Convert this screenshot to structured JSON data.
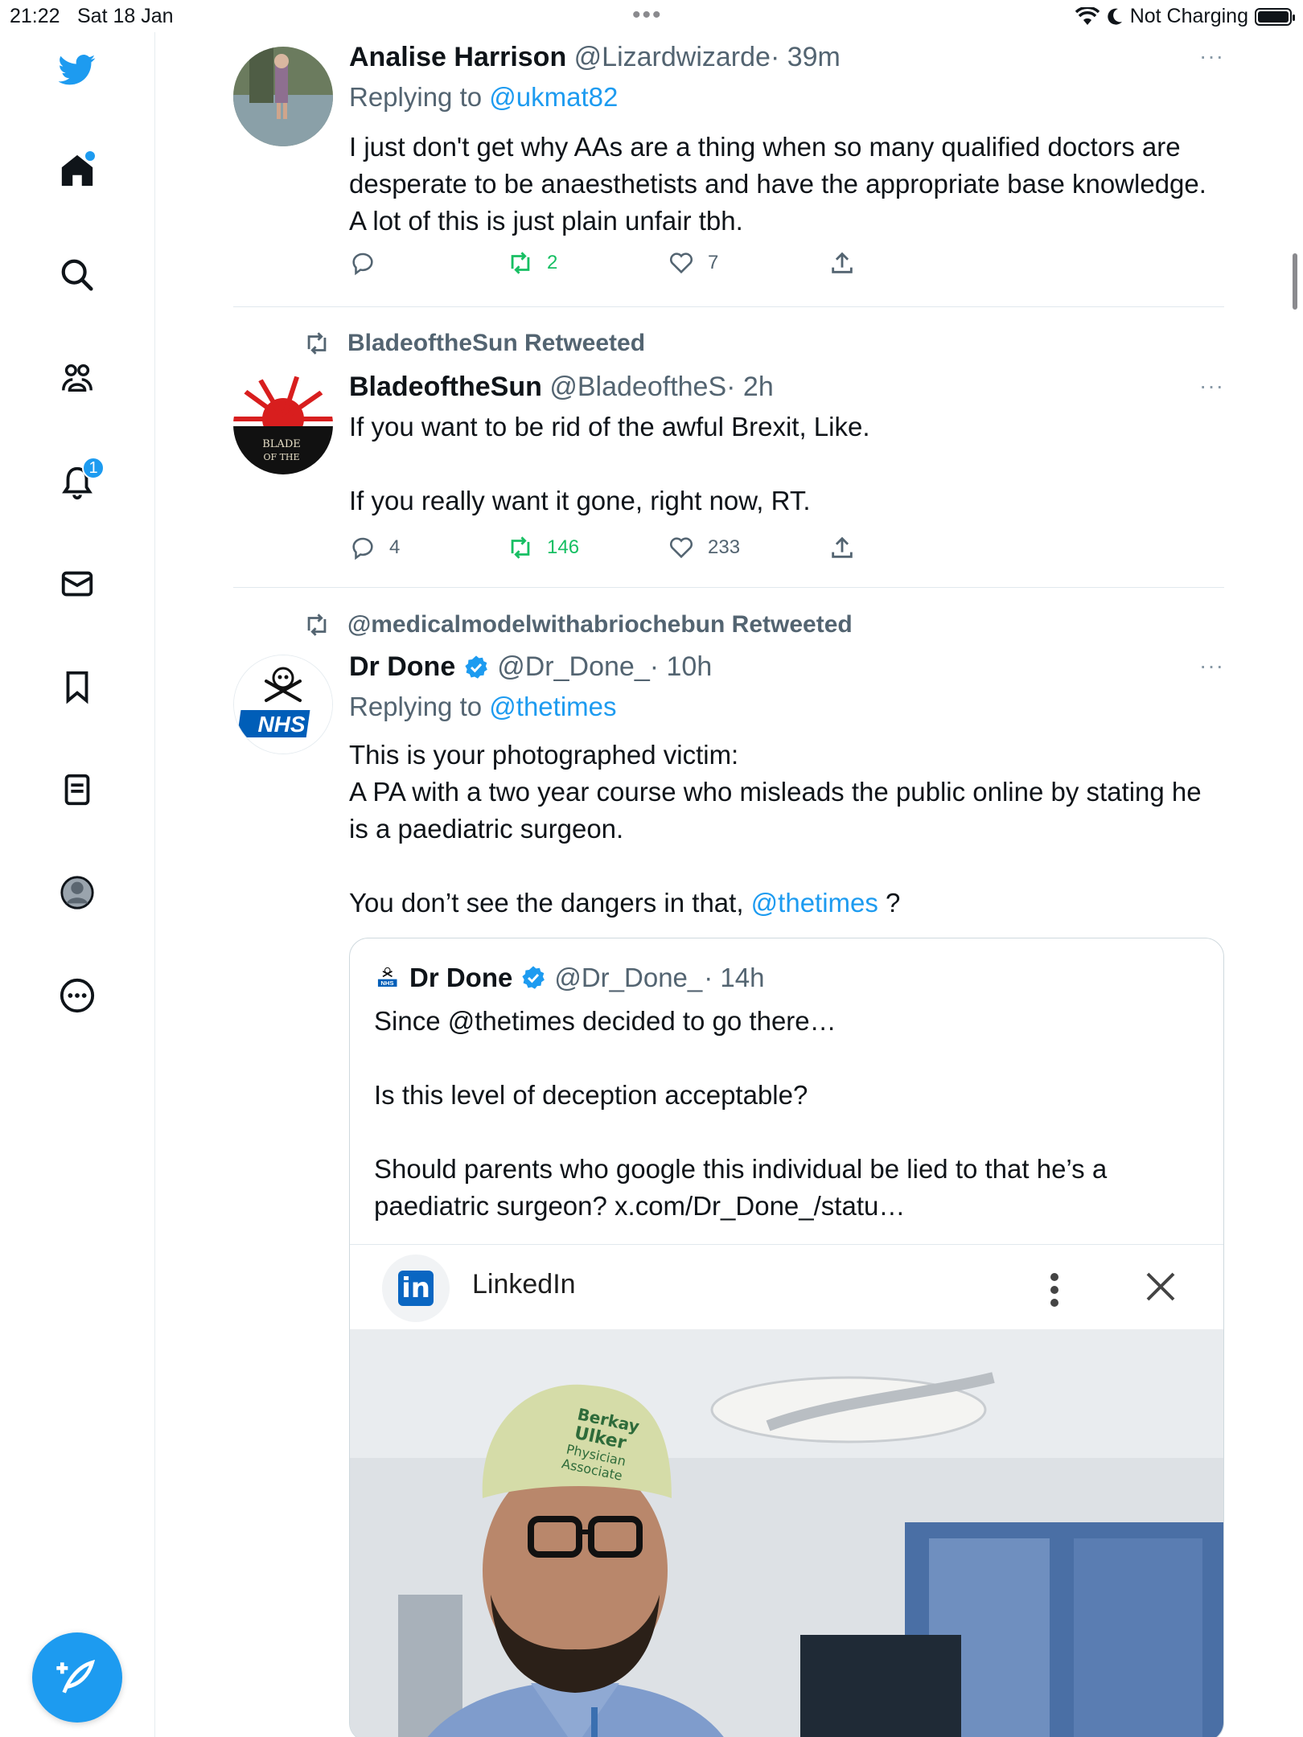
{
  "status_bar": {
    "time": "21:22",
    "date": "Sat 18 Jan",
    "multitask": "•••",
    "charging": "Not Charging"
  },
  "sidebar": {
    "items": [
      {
        "icon": "twitter-bird-icon"
      },
      {
        "icon": "home-icon"
      },
      {
        "icon": "search-icon"
      },
      {
        "icon": "communities-icon"
      },
      {
        "icon": "notifications-icon",
        "badge": "1"
      },
      {
        "icon": "messages-icon"
      },
      {
        "icon": "bookmarks-icon"
      },
      {
        "icon": "lists-icon"
      },
      {
        "icon": "profile-icon"
      },
      {
        "icon": "more-icon"
      }
    ],
    "compose_icon": "compose-tweet-icon"
  },
  "colors": {
    "accent": "#1d9bf0",
    "retweet_green": "#17bf63",
    "secondary_text": "#536471"
  },
  "tweets": [
    {
      "name": "Analise Harrison",
      "handle": "@Lizardwizarde",
      "time": "· 39m",
      "more": "···",
      "replying_prefix": "Replying to",
      "replying_to": "@ukmat82",
      "text": "I just don't get why AAs are a thing when so many qualified doctors are desperate to be anaesthetists and have the appropriate base knowledge. A lot of this is just plain unfair tbh.",
      "replies": "",
      "retweets": "2",
      "likes": "7"
    },
    {
      "retweeted_by": "BladeoftheSun Retweeted",
      "name": "BladeoftheSun",
      "handle": "@BladeoftheS",
      "time": "· 2h",
      "more": "···",
      "avatar_text_1": "BLADE",
      "avatar_text_2": "OF THE",
      "text_1": "If you want to be rid of the awful Brexit, Like.",
      "text_2": "If you really want it gone, right now, RT.",
      "replies": "4",
      "retweets": "146",
      "likes": "233"
    },
    {
      "retweeted_by": "@medicalmodelwithabriochebun Retweeted",
      "name": "Dr Done",
      "handle": "@Dr_Done_",
      "time": "· 10h",
      "more": "···",
      "avatar_text": "NHS",
      "replying_prefix": "Replying to",
      "replying_to": "@thetimes",
      "text_1": "This is your photographed victim:",
      "text_2": "A PA with a two year course who misleads the public online by stating he is a paediatric surgeon.",
      "text_3": "You don’t see the dangers in that,",
      "text_3_link": "@thetimes",
      "text_3_end": " ?",
      "quote": {
        "avatar_text": "NHS",
        "name": "Dr Done",
        "handle": "@Dr_Done_",
        "time": "· 14h",
        "text_1": "Since @thetimes decided to go there…",
        "text_2": "Is this level of deception acceptable?",
        "text_3": "Should parents who google this individual be lied to that he’s a paediatric surgeon? x.com/Dr_Done_/statu…",
        "card_logo": "in",
        "card_title": "LinkedIn",
        "cap_text_1": "Berkay",
        "cap_text_2": "Ulker",
        "cap_text_3": "Physician",
        "cap_text_4": "Associate"
      }
    }
  ]
}
